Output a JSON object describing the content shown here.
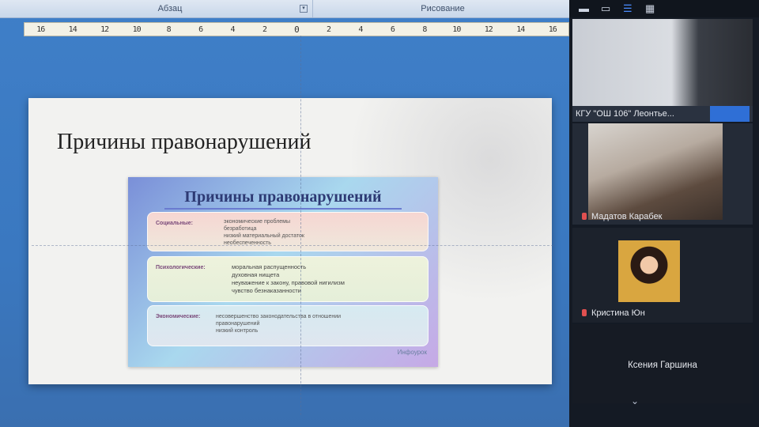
{
  "ribbon": {
    "group_paragraph": "Абзац",
    "group_drawing": "Рисование",
    "launcher": "▾"
  },
  "ruler": {
    "ticks": [
      "16",
      "14",
      "12",
      "10",
      "8",
      "6",
      "4",
      "2",
      "0",
      "2",
      "4",
      "6",
      "8",
      "10",
      "12",
      "14",
      "16"
    ]
  },
  "document": {
    "slide_title": "Причины правонарушений",
    "inner_title": "Причины правонарушений",
    "boxes": [
      {
        "label": "Социальные:",
        "lines": [
          "экономические проблемы",
          "безработица",
          "низкий материальный достаток",
          "необеспеченность"
        ]
      },
      {
        "label": "Психологические:",
        "lines": [
          "моральная распущенность",
          "духовная нищета",
          "неуважение к закону, правовой нигилизм",
          "чувство безнаказанности"
        ]
      },
      {
        "label": "Экономические:",
        "lines": [
          "несовершенство законодательства в отношении",
          "правонарушений",
          "низкий контроль"
        ]
      }
    ],
    "watermark": "Инфоурок"
  },
  "zoom": {
    "toolbar": {
      "minimize": "▬",
      "speaker": "▭",
      "strip": "☰",
      "gallery": "▦"
    },
    "participants": [
      {
        "name": "КГУ \"ОШ 106\" Леонтье..."
      },
      {
        "name": "Мадатов Карабек"
      },
      {
        "name": "Кристина Юн"
      },
      {
        "name": "Ксения Гаршина"
      }
    ],
    "scroll": "⌄"
  }
}
